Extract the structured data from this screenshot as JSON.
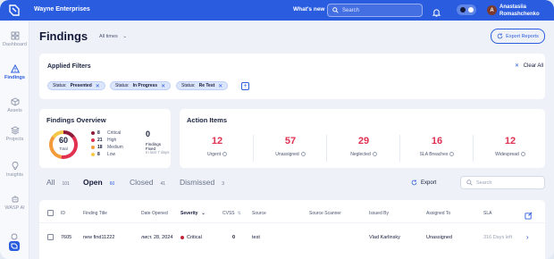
{
  "topbar": {
    "org_name": "Wayne Enterprises",
    "whats_new": "What's new",
    "search_placeholder": "Search",
    "user_first": "Anastasiia",
    "user_last": "Romashchenko",
    "avatar_letter": "A",
    "brand_color": "#2a5ce0"
  },
  "sidebar": {
    "items": [
      {
        "label": "Dashboard",
        "icon": "dashboard-icon"
      },
      {
        "label": "Findings",
        "icon": "warning-triangle-icon",
        "active": true
      },
      {
        "label": "Assets",
        "icon": "cube-icon"
      },
      {
        "label": "Projects",
        "icon": "layers-icon"
      },
      {
        "label": "Insights",
        "icon": "lightbulb-icon"
      },
      {
        "label": "WASP AI",
        "icon": "robot-icon"
      }
    ]
  },
  "header": {
    "title": "Findings",
    "range": "All times",
    "export_reports": "Export Reports"
  },
  "filters": {
    "heading": "Applied Filters",
    "clear_all": "Clear All",
    "chips": [
      {
        "key": "Status:",
        "value": "Presented"
      },
      {
        "key": "Status:",
        "value": "In Progress"
      },
      {
        "key": "Status:",
        "value": "Re Test"
      }
    ]
  },
  "overview": {
    "heading": "Findings Overview",
    "total": "60",
    "total_label": "Total",
    "legend": [
      {
        "count": "8",
        "label": "Critical",
        "color": "#8e1b3a"
      },
      {
        "count": "21",
        "label": "High",
        "color": "#e0314f"
      },
      {
        "count": "18",
        "label": "Medium",
        "color": "#f39a3a"
      },
      {
        "count": "8",
        "label": "Low",
        "color": "#f5c84a"
      }
    ],
    "fixed_count": "0",
    "fixed_label": "Findings Fixed",
    "fixed_sub": "In last 7 days"
  },
  "actions": {
    "heading": "Action Items",
    "items": [
      {
        "value": "12",
        "label": "Urgent"
      },
      {
        "value": "57",
        "label": "Unassigned"
      },
      {
        "value": "29",
        "label": "Neglected"
      },
      {
        "value": "16",
        "label": "SLA Breaches"
      },
      {
        "value": "12",
        "label": "Widespread"
      }
    ]
  },
  "tabs": [
    {
      "label": "All",
      "count": "101"
    },
    {
      "label": "Open",
      "count": "60",
      "active": true
    },
    {
      "label": "Closed",
      "count": "41"
    },
    {
      "label": "Dismissed",
      "count": "3"
    }
  ],
  "toolbar": {
    "export": "Export",
    "search_placeholder": "Search"
  },
  "table": {
    "columns": [
      "ID",
      "Finding Title",
      "Date Opened",
      "Severity",
      "CVSS",
      "Source",
      "Source Scanner",
      "Issued By",
      "Assigned To",
      "SLA"
    ],
    "rows": [
      {
        "id": "7605",
        "title": "new find11222",
        "date": "лист. 28, 2024",
        "severity": "Critical",
        "cvss": "0",
        "source": "test",
        "scanner": "",
        "issued_by": "Vlad Karlinsky",
        "assigned_to": "Unassigned",
        "sla": "316 Days left"
      }
    ]
  }
}
